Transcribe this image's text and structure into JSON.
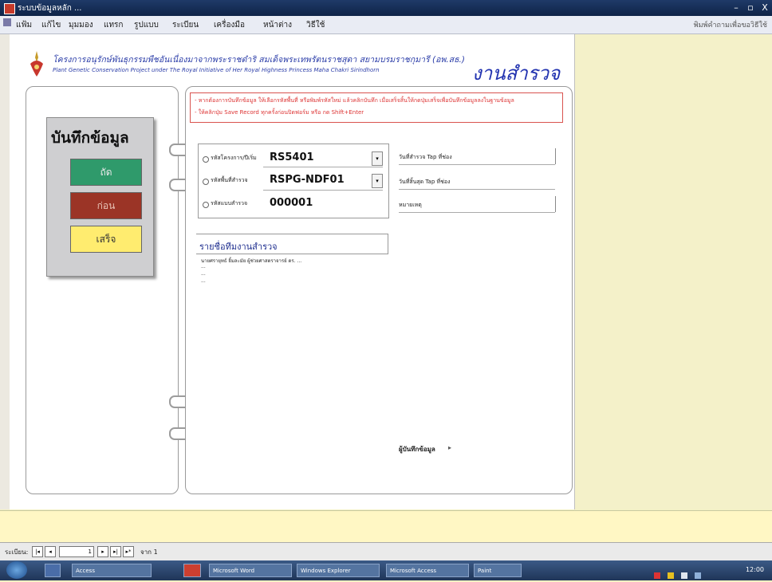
{
  "window": {
    "title": "ระบบข้อมูลหลัก ...",
    "min": "–",
    "max": "▫",
    "close": "X"
  },
  "menu": {
    "items": [
      "แฟ้ม",
      "แก้ไข",
      "มุมมอง",
      "แทรก",
      "รูปแบบ",
      "ระเบียน",
      "เครื่องมือ",
      "หน้าต่าง",
      "วิธีใช้"
    ],
    "right": "พิมพ์คำถามเพื่อขอวิธีใช้"
  },
  "header": {
    "line1": "โครงการอนุรักษ์พันธุกรรมพืชอันเนื่องมาจากพระราชดำริ สมเด็จพระเทพรัตนราชสุดา สยามบรมราชกุมารี (อพ.สธ.)",
    "line2": "Plant Genetic Conservation Project under The Royal Initiative of Her Royal Highness Princess Maha Chakri Sirindhorn",
    "title": "งานสำรวจ"
  },
  "leftpanel": {
    "title": "บันทึกข้อมูล",
    "next": "ถัด",
    "prev": "ก่อน",
    "done": "เสร็จ"
  },
  "notice": {
    "line1": "- หากต้องการบันทึกข้อมูล ให้เลือกรหัสพื้นที่ หรือพิมพ์รหัสใหม่ แล้วคลิกบันทึก เมื่อเสร็จสิ้นให้กดปุ่มเสร็จเพื่อบันทึกข้อมูลลงในฐานข้อมูล",
    "line2": "- ให้คลิกปุ่ม Save Record  ทุกครั้งก่อนปิดฟอร์ม หรือ กด Shift+Enter"
  },
  "fields": [
    {
      "label": "รหัสโครงการ/ปีเริ่ม",
      "value": "RS5401",
      "dropdown": true
    },
    {
      "label": "รหัสพื้นที่สำรวจ",
      "value": "RSPG-NDF01",
      "dropdown": true
    },
    {
      "label": "รหัสแบบสำรวจ",
      "value": "000001",
      "dropdown": false
    }
  ],
  "right_fields": {
    "date_start": "วันที่สำรวจ Tap ที่ช่อง",
    "date_end": "วันที่สิ้นสุด Tap ที่ช่อง",
    "remark": "หมายเหตุ"
  },
  "names": {
    "heading": "รายชื่อทีมงานสำรวจ",
    "line1": "นายศรายุทธ์ ยิ้มละมัย ผู้ช่วยศาสตราจารย์ ดร. ...",
    "line2": "...",
    "line3": "...",
    "line4": "..."
  },
  "recorder": "ผู้บันทึกข้อมูล",
  "recordnav": {
    "label": "ระเบียน:",
    "current": "1",
    "total": "จาก 1"
  },
  "taskbar": {
    "items": [
      "Access",
      "Microsoft Word",
      "Windows Explorer",
      "Microsoft Access",
      "Paint"
    ],
    "clock": "12:00"
  }
}
